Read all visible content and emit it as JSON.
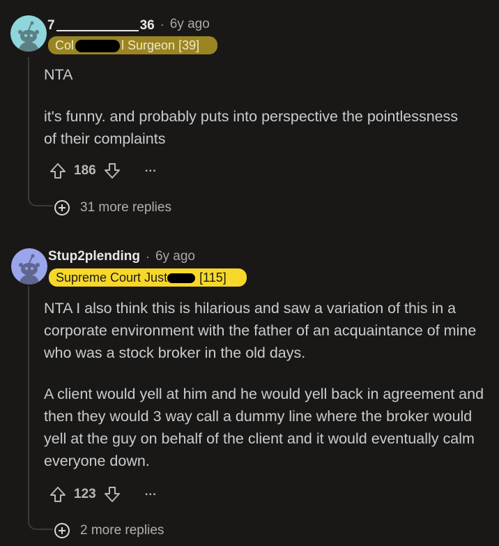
{
  "comments": [
    {
      "username_start": "7",
      "username_end": "36",
      "separator": "·",
      "time": "6y ago",
      "flair_start": "Col",
      "flair_end": "l Surgeon [39]",
      "body": [
        "NTA",
        "it's funny. and probably puts into perspective the pointlessness of their complaints"
      ],
      "score": "186",
      "more_label": "...",
      "more_replies": "31 more replies",
      "flair_color": "#9b8522"
    },
    {
      "username": "Stup2plending",
      "separator": "·",
      "time": "6y ago",
      "flair_start": "Supreme Court Just",
      "flair_end": "[115]",
      "body": [
        "NTA I also think this is hilarious and saw a variation of this in a corporate environment with the father of an acquaintance of mine who was a stock broker in the old days.",
        "A client would yell at him and he would yell back in agreement and then they would 3 way call a dummy line where the broker would yell at the guy on behalf of the client and it would eventually calm everyone down."
      ],
      "score": "123",
      "more_label": "...",
      "more_replies": "2 more replies",
      "flair_color": "#f7d82a"
    }
  ],
  "colors": {
    "background": "#1a1817",
    "text": "#c9cccd",
    "avatar": "#8fd6dc",
    "avatar2": "#9aa5ea"
  }
}
